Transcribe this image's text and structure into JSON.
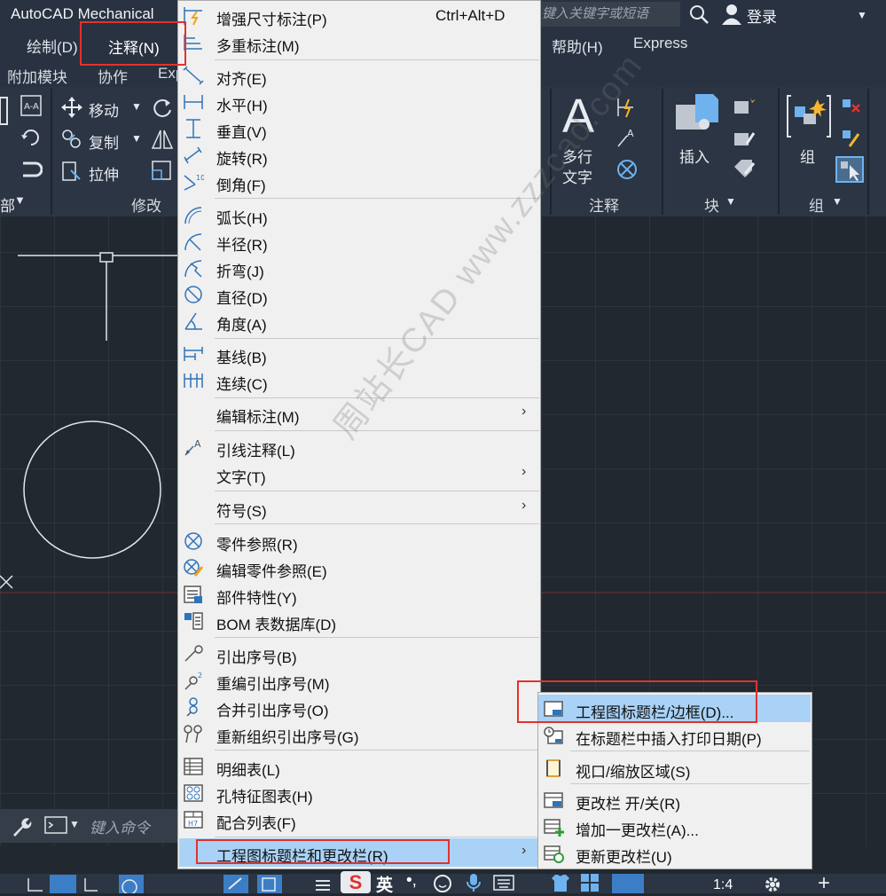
{
  "app": {
    "title": "AutoCAD Mechanical",
    "search_placeholder": "键入关键字或短语",
    "login_label": "登录"
  },
  "menubar": {
    "items": [
      {
        "label": "绘制(D)"
      },
      {
        "label": "注释(N)"
      },
      {
        "label": "帮助(H)"
      },
      {
        "label": "Express"
      }
    ]
  },
  "ribbon_tabs": [
    "附加模块",
    "协作",
    "Exp"
  ],
  "ribbon": {
    "modify": {
      "title": "修改",
      "move": "移动",
      "copy": "复制",
      "stretch": "拉伸"
    },
    "annotation": {
      "title": "注释",
      "mtext_line1": "多行",
      "mtext_line2": "文字"
    },
    "block": {
      "title": "块",
      "insert": "插入"
    },
    "group": {
      "title": "组",
      "group": "组"
    },
    "left_partial": "部"
  },
  "command_line": {
    "placeholder": "键入命令"
  },
  "annotate_menu": {
    "items": [
      {
        "label": "增强尺寸标注(P)",
        "shortcut": "Ctrl+Alt+D"
      },
      {
        "label": "多重标注(M)"
      },
      {
        "label": "对齐(E)"
      },
      {
        "label": "水平(H)"
      },
      {
        "label": "垂直(V)"
      },
      {
        "label": "旋转(R)"
      },
      {
        "label": "倒角(F)"
      },
      {
        "label": "弧长(H)"
      },
      {
        "label": "半径(R)"
      },
      {
        "label": "折弯(J)"
      },
      {
        "label": "直径(D)"
      },
      {
        "label": "角度(A)"
      },
      {
        "label": "基线(B)"
      },
      {
        "label": "连续(C)"
      },
      {
        "label": "编辑标注(M)"
      },
      {
        "label": "引线注释(L)"
      },
      {
        "label": "文字(T)"
      },
      {
        "label": "符号(S)"
      },
      {
        "label": "零件参照(R)"
      },
      {
        "label": "编辑零件参照(E)"
      },
      {
        "label": "部件特性(Y)"
      },
      {
        "label": "BOM 表数据库(D)"
      },
      {
        "label": "引出序号(B)"
      },
      {
        "label": "重编引出序号(M)"
      },
      {
        "label": "合并引出序号(O)"
      },
      {
        "label": "重新组织引出序号(G)"
      },
      {
        "label": "明细表(L)"
      },
      {
        "label": "孔特征图表(H)"
      },
      {
        "label": "配合列表(F)"
      },
      {
        "label": "工程图标题栏和更改栏(R)"
      }
    ],
    "submenu_arrow": "›"
  },
  "submenu": {
    "items": [
      {
        "label": "工程图标题栏/边框(D)..."
      },
      {
        "label": "在标题栏中插入打印日期(P)"
      },
      {
        "label": "视口/缩放区域(S)"
      },
      {
        "label": "更改栏 开/关(R)"
      },
      {
        "label": "增加一更改栏(A)..."
      },
      {
        "label": "更新更改栏(U)"
      }
    ]
  },
  "statusbar": {
    "scale": "1:4",
    "ime_lang": "英"
  },
  "watermark": "周站长CAD  www.zzzcad.com",
  "colors": {
    "accent_red": "#e1322d",
    "highlight": "#a9d2f6",
    "menu_bg": "#f0f0f0",
    "dark_bg": "#212830"
  }
}
